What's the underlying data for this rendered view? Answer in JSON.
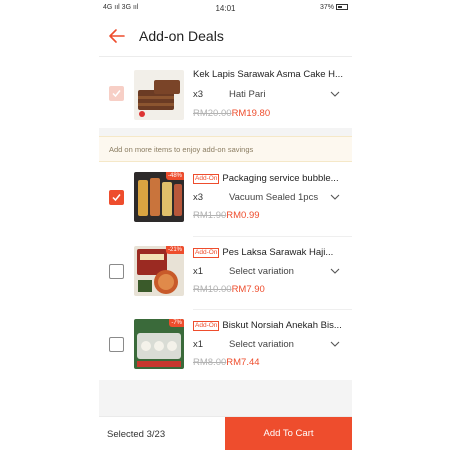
{
  "status_bar": {
    "network": "4G ııl 3G ııl",
    "time": "14:01",
    "battery": "37%"
  },
  "header": {
    "title": "Add-on Deals"
  },
  "main_item": {
    "name": "Kek Lapis Sarawak Asma Cake H...",
    "qty": "x3",
    "variation": "Hati Pari",
    "original_price": "RM20.00",
    "price": "RM19.80"
  },
  "hint_text": "Add on more items to enjoy add-on savings",
  "addons": [
    {
      "tag": "Add-On",
      "name": "Packaging service bubble...",
      "discount": "-48%",
      "qty": "x3",
      "variation": "Vacuum Sealed 1pcs",
      "original_price": "RM1.90",
      "price": "RM0.99",
      "checked": true
    },
    {
      "tag": "Add-On",
      "name": "Pes Laksa Sarawak Haji...",
      "discount": "-21%",
      "qty": "x1",
      "variation": "Select variation",
      "original_price": "RM10.00",
      "price": "RM7.90",
      "checked": false
    },
    {
      "tag": "Add-On",
      "name": "Biskut Norsiah Anekah Bis...",
      "discount": "-7%",
      "qty": "x1",
      "variation": "Select variation",
      "original_price": "RM8.00",
      "price": "RM7.44",
      "checked": false
    }
  ],
  "footer": {
    "selected": "Selected 3/23",
    "button_label": "Add To Cart"
  },
  "colors": {
    "accent": "#ee4d2d",
    "disabled_check": "#f7cfc6",
    "hint_bg": "#fdf8ef"
  }
}
